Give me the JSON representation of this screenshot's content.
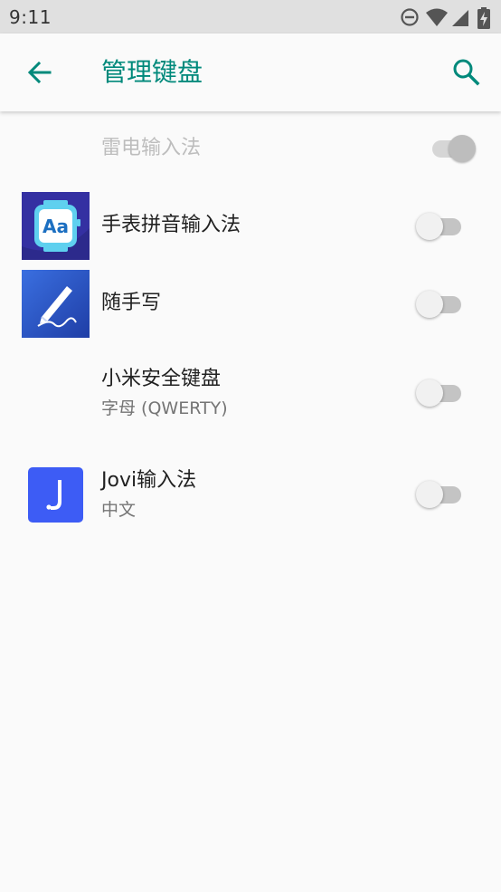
{
  "status_bar": {
    "time": "9:11",
    "icons": [
      "do-not-disturb-icon",
      "wifi-icon",
      "cell-signal-icon",
      "battery-charging-icon"
    ]
  },
  "app_bar": {
    "title": "管理键盘",
    "back_icon": "arrow-back-icon",
    "search_icon": "search-icon",
    "accent_color": "#00897b"
  },
  "keyboards": [
    {
      "name": "雷电输入法",
      "subtitle": "",
      "enabled": true,
      "toggle_disabled": true
    },
    {
      "name": "手表拼音输入法",
      "subtitle": "",
      "enabled": false,
      "icon": "watch-keyboard-icon"
    },
    {
      "name": "随手写",
      "subtitle": "",
      "enabled": false,
      "icon": "handwriting-pen-icon"
    },
    {
      "name": "小米安全键盘",
      "subtitle": "字母 (QWERTY)",
      "enabled": false
    },
    {
      "name": "Jovi输入法",
      "subtitle": "中文",
      "enabled": false,
      "icon": "jovi-icon"
    }
  ]
}
